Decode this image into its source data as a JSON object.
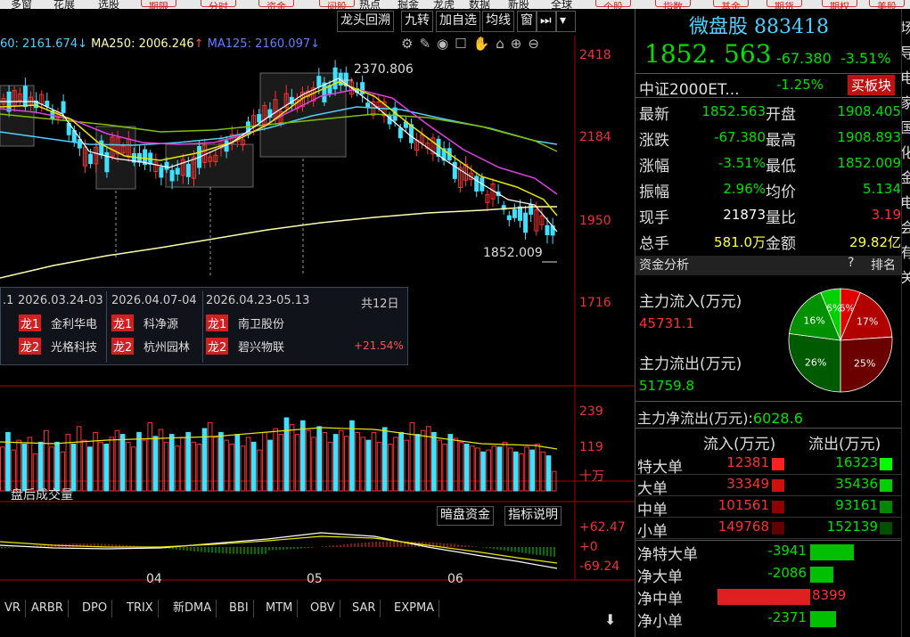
{
  "top_menu": [
    {
      "label": "多窗"
    },
    {
      "label": "花展"
    },
    {
      "label": "选股"
    },
    {
      "label": "期限"
    },
    {
      "label": "分时"
    },
    {
      "label": "资金"
    },
    {
      "label": "问股"
    },
    {
      "label": "热点"
    },
    {
      "label": "掘金"
    },
    {
      "label": "龙虎"
    },
    {
      "label": "数据"
    },
    {
      "label": "新股"
    },
    {
      "label": "全球"
    },
    {
      "label": "个股"
    },
    {
      "label": "指数"
    },
    {
      "label": "基金"
    },
    {
      "label": "期货"
    },
    {
      "label": "期权"
    },
    {
      "label": "美股"
    }
  ],
  "toolbar": {
    "buttons": [
      "龙头回溯",
      "九转",
      "加自选",
      "均线",
      "窗"
    ]
  },
  "ma_line": {
    "ma60": "60: 2161.674",
    "ma60_arrow": "↓",
    "ma250": "MA250: 2006.246",
    "ma250_arrow": "↑",
    "ma125": "MA125: 2160.097",
    "ma125_arrow": "↓"
  },
  "y_axis": {
    "t1": "2418",
    "t2": "2184",
    "t3": "1950",
    "t4": "1716"
  },
  "annotations": {
    "high": "2370.806",
    "low": "1852.009"
  },
  "dragon_panel": {
    "period0": ".1",
    "period1": "2026.03.24-03",
    "period2": "2026.04.07-04",
    "period3": "2026.04.23-05.13",
    "total": "共12日",
    "rank1": "龙1",
    "rank2": "龙2",
    "c1r1": "金利华电",
    "c1r2": "光格科技",
    "c2r1": "科净源",
    "c2r2": "杭州园林",
    "c3r1": "南卫股份",
    "c3r2": "碧兴物联",
    "pct": "+21.54%"
  },
  "volume": {
    "t1": "239",
    "t2": "119",
    "unit": "十万",
    "after_label": "盘后成交量",
    "bars": [
      45,
      60,
      42,
      52,
      48,
      55,
      38,
      50,
      62,
      45,
      50,
      40,
      58,
      48,
      66,
      52,
      45,
      60,
      50,
      48,
      55,
      62,
      58,
      50,
      45,
      60,
      52,
      70,
      56,
      63,
      50,
      58,
      46,
      55,
      60,
      50,
      48,
      64,
      70,
      55,
      60,
      52,
      48,
      58,
      46,
      55,
      50,
      42,
      60,
      52,
      64,
      58,
      75,
      68,
      58,
      72,
      62,
      55,
      66,
      60,
      50,
      58,
      62,
      56,
      72,
      60,
      55,
      52,
      60,
      50,
      65,
      48,
      55,
      60,
      52,
      70,
      58,
      62,
      66,
      60,
      52,
      48,
      58,
      54,
      50,
      48,
      46,
      44,
      40,
      42,
      46,
      45,
      50,
      44,
      40,
      38,
      45,
      42,
      48,
      40,
      36,
      20
    ]
  },
  "macd": {
    "btn1": "暗盘资金",
    "btn2": "指标说明",
    "t1": "+62.47",
    "t2": "+0",
    "t3": "-69.24"
  },
  "x_axis": {
    "m04": "04",
    "m05": "05",
    "m06": "06"
  },
  "indicator_tabs": [
    "VR",
    "ARBR",
    "DPO",
    "TRIX",
    "新DMA",
    "BBI",
    "MTM",
    "OBV",
    "SAR",
    "EXPMA"
  ],
  "stock": {
    "name": "微盘股",
    "code": "883418",
    "price": "1852. 563",
    "change": "-67.380",
    "pct": "-3.51%"
  },
  "related": {
    "name": "中证2000ET...",
    "pct": "-1.25%",
    "btn": "买板块"
  },
  "quote": [
    {
      "l": "最新",
      "v": "1852.563",
      "l2": "开盘",
      "v2": "1908.405"
    },
    {
      "l": "涨跌",
      "v": "-67.380",
      "l2": "最高",
      "v2": "1908.893"
    },
    {
      "l": "涨幅",
      "v": "-3.51%",
      "l2": "最低",
      "v2": "1852.009"
    },
    {
      "l": "振幅",
      "v": "2.96%",
      "l2": "均价",
      "v2": "5.134"
    },
    {
      "l": "现手",
      "v": "21873",
      "l2": "量比",
      "v2": "3.19"
    },
    {
      "l": "总手",
      "v": "581.0万",
      "l2": "金额",
      "v2": "29.82亿"
    }
  ],
  "fund": {
    "title": "资金分析",
    "help": "?",
    "rank": "排名",
    "in_label": "主力流入(万元)",
    "in_val": "45731.1",
    "out_label": "主力流出(万元)",
    "out_val": "51759.8",
    "net_label": "主力净流出(万元):",
    "net_val": "6028.6",
    "pie": [
      {
        "label": "6%",
        "value": 6,
        "color": "#e00000"
      },
      {
        "label": "17%",
        "value": 17,
        "color": "#b00000"
      },
      {
        "label": "25%",
        "value": 25,
        "color": "#6a0000"
      },
      {
        "label": "26%",
        "value": 26,
        "color": "#005a00"
      },
      {
        "label": "16%",
        "value": 16,
        "color": "#009000"
      },
      {
        "label": "6%",
        "value": 6,
        "color": "#00d000"
      }
    ]
  },
  "flow": {
    "h_in": "流入(万元)",
    "h_out": "流出(万元)",
    "rows": [
      {
        "l": "特大单",
        "in": "12381",
        "out": "16323"
      },
      {
        "l": "大单",
        "in": "33349",
        "out": "35436"
      },
      {
        "l": "中单",
        "in": "101561",
        "out": "93161"
      },
      {
        "l": "小单",
        "in": "149768",
        "out": "152139"
      }
    ]
  },
  "net": {
    "rows": [
      {
        "l": "净特大单",
        "v": "-3941",
        "frac": 0.47,
        "color": "#00c000"
      },
      {
        "l": "净大单",
        "v": "-2086",
        "frac": 0.25,
        "color": "#00c000"
      },
      {
        "l": "净中单",
        "v": "8399",
        "frac": 1.0,
        "color": "#e02020"
      },
      {
        "l": "净小单",
        "v": "-2371",
        "frac": 0.28,
        "color": "#00c000"
      }
    ]
  },
  "edge": [
    "场",
    "导",
    "电",
    "家",
    "国",
    "化",
    "金",
    "电",
    "会",
    "有",
    "关"
  ]
}
